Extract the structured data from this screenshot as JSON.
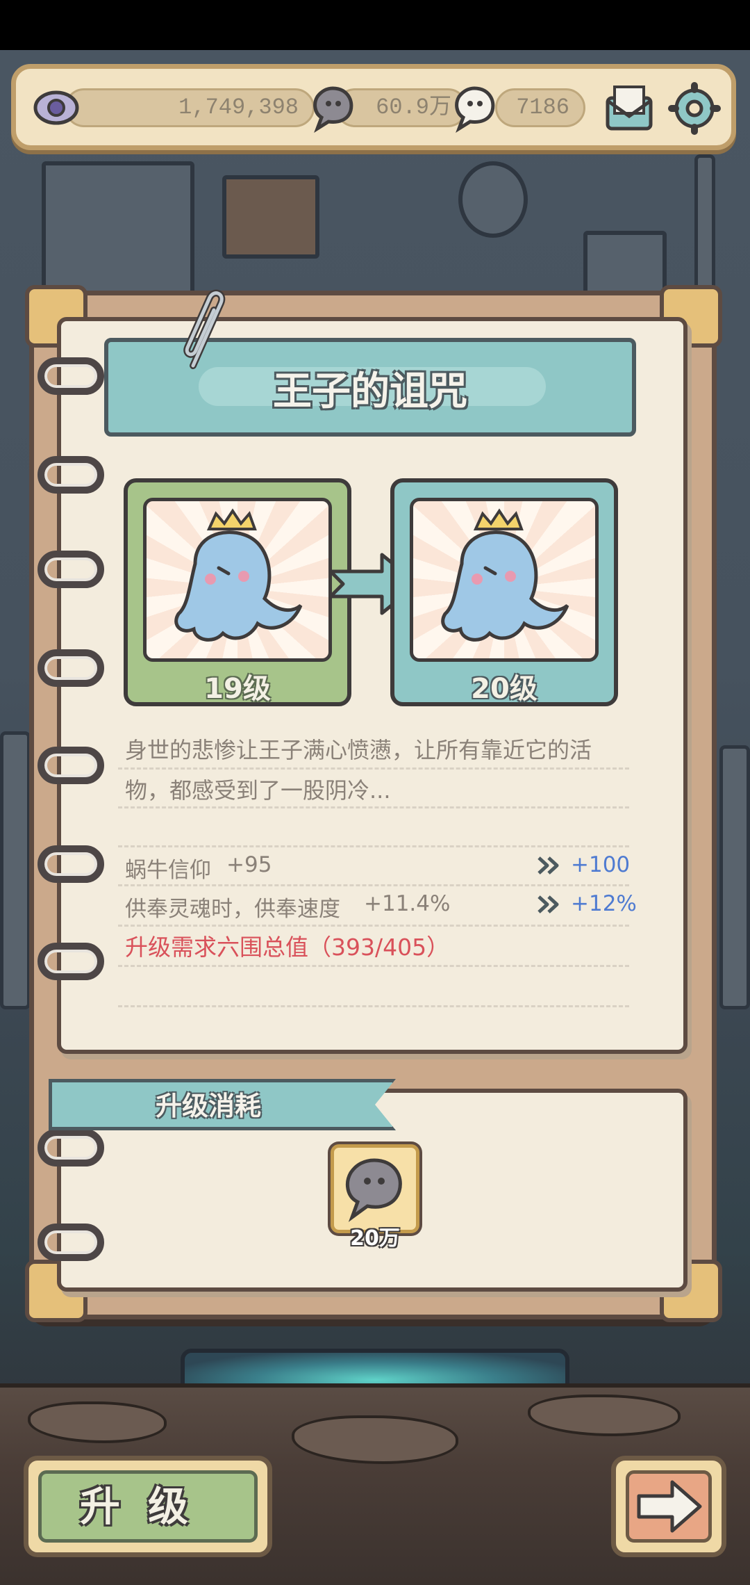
{
  "resources": {
    "views": "1,749,398",
    "snail_spirit": "60.9万",
    "ghost_soul": "7186"
  },
  "icons": {
    "eye": "eye-icon",
    "snail_spirit": "snail-spirit-icon",
    "ghost_soul": "ghost-soul-icon",
    "mail": "mail-icon",
    "settings": "gear-icon"
  },
  "card": {
    "title": "王子的诅咒",
    "current_level": "19级",
    "next_level": "20级",
    "description": "身世的悲惨让王子满心愤懑，让所有靠近它的活物，都感受到了一股阴冷..."
  },
  "stats": [
    {
      "label": "蜗牛信仰",
      "value": "+95",
      "next": "+100"
    },
    {
      "label": "供奉灵魂时，供奉速度",
      "value": "+11.4%",
      "next": "+12%"
    }
  ],
  "requirement": "升级需求六围总值（393/405）",
  "cost": {
    "title": "升级消耗",
    "amount": "20万"
  },
  "buttons": {
    "upgrade": "升级"
  },
  "colors": {
    "accent_teal": "#8fc7c6",
    "accent_green": "#a7c48a",
    "requirement_red": "#d9515a",
    "stat_up_blue": "#4f7bd1",
    "paper": "#f3ecdd"
  }
}
